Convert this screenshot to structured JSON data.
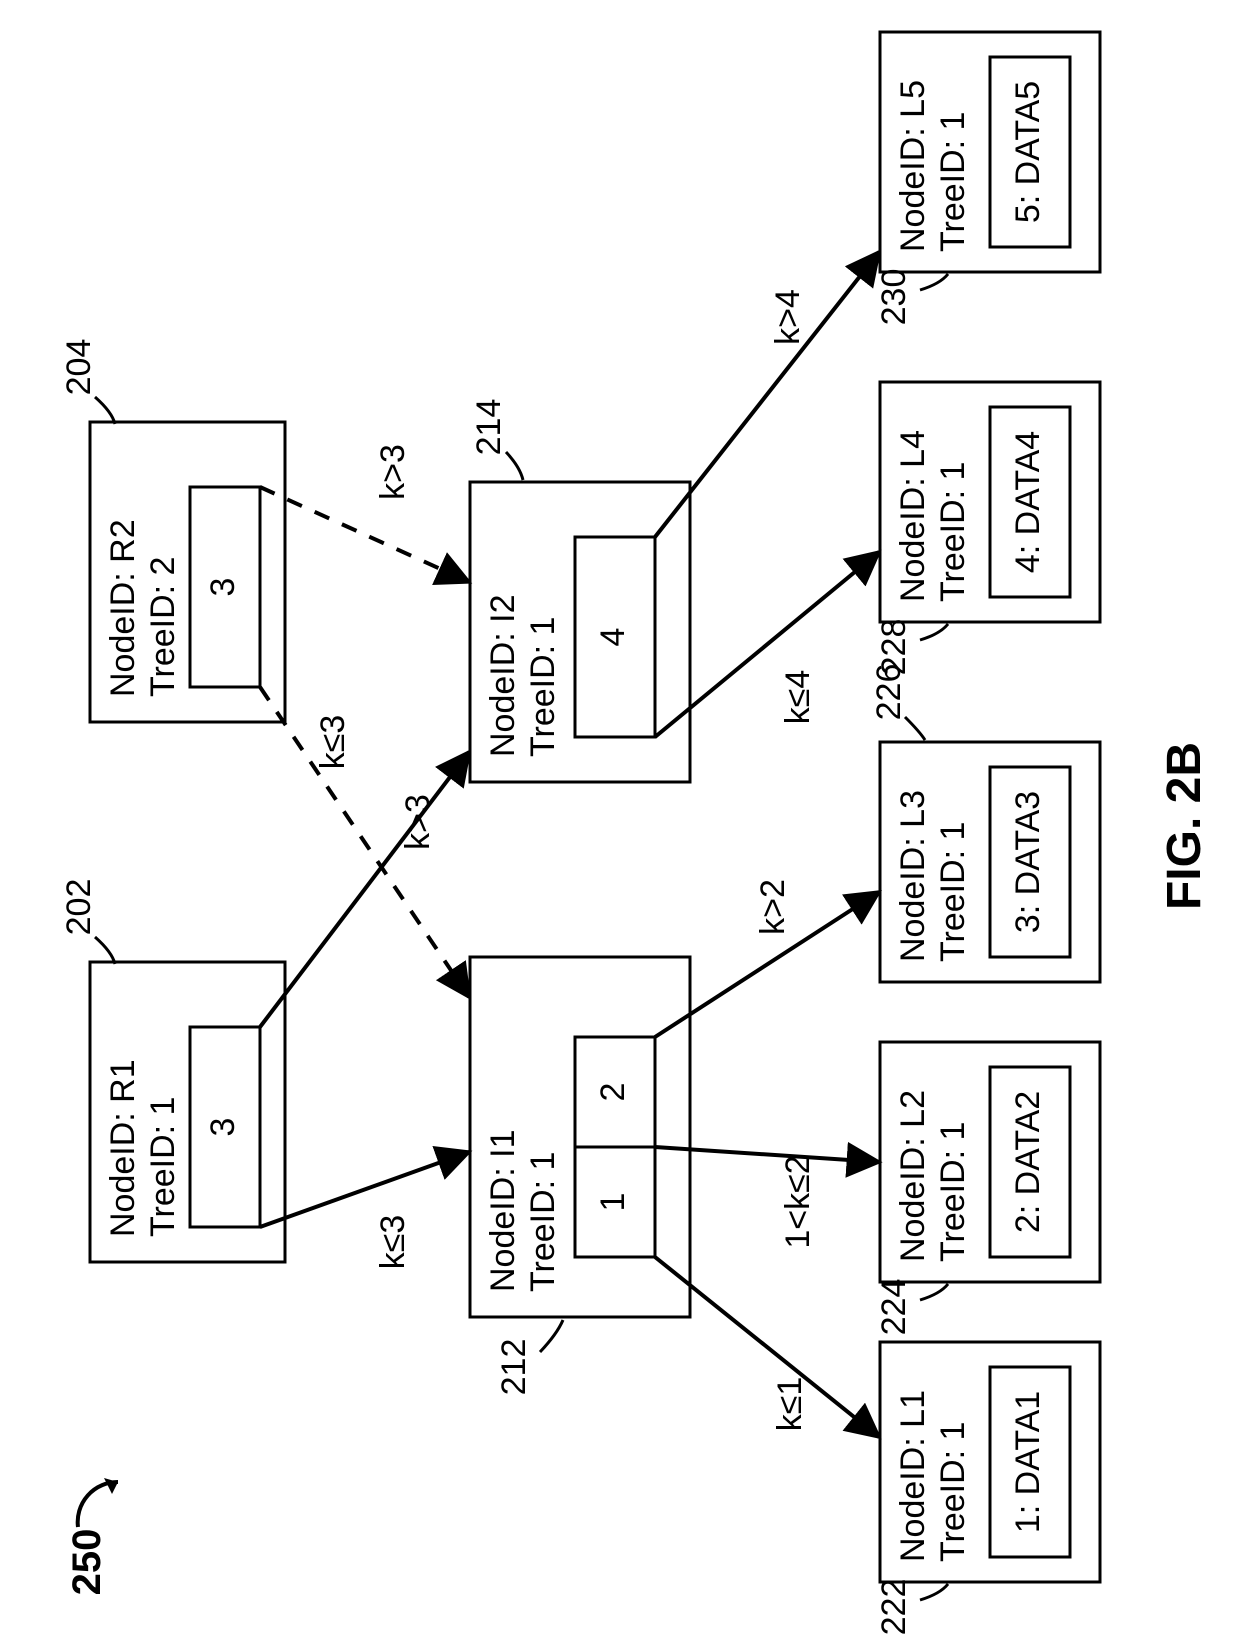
{
  "figureRef": "250",
  "figureLabel": "FIG. 2B",
  "nodes": {
    "R1": {
      "nodeId": "NodeID:  R1",
      "treeId": "TreeID: 1",
      "keys": [
        "3"
      ],
      "ref": "202"
    },
    "R2": {
      "nodeId": "NodeID: R2",
      "treeId": "TreeID: 2",
      "keys": [
        "3"
      ],
      "ref": "204"
    },
    "I1": {
      "nodeId": "NodeID: I1",
      "treeId": "TreeID: 1",
      "keys": [
        "1",
        "2"
      ],
      "ref": "212"
    },
    "I2": {
      "nodeId": "NodeID: I2",
      "treeId": "TreeID: 1",
      "keys": [
        "4"
      ],
      "ref": "214"
    },
    "L1": {
      "nodeId": "NodeID: L1",
      "treeId": "TreeID: 1",
      "data": "1: DATA1",
      "ref": "222"
    },
    "L2": {
      "nodeId": "NodeID: L2",
      "treeId": "TreeID: 1",
      "data": "2: DATA2",
      "ref": "224"
    },
    "L3": {
      "nodeId": "NodeID: L3",
      "treeId": "TreeID: 1",
      "data": "3: DATA3",
      "ref": "226"
    },
    "L4": {
      "nodeId": "NodeID: L4",
      "treeId": "TreeID: 1",
      "data": "4: DATA4",
      "ref": "228"
    },
    "L5": {
      "nodeId": "NodeID: L5",
      "treeId": "TreeID: 1",
      "data": "5: DATA5",
      "ref": "230"
    }
  },
  "edges": {
    "R1_I1": "k≤3",
    "R1_I2": "k>3",
    "R2_I1": "k≤3",
    "R2_I2": "k>3",
    "I1_L1": "k≤1",
    "I1_L2": "1<k≤2",
    "I1_L3": "k>2",
    "I2_L4": "k≤4",
    "I2_L5": "k>4"
  }
}
